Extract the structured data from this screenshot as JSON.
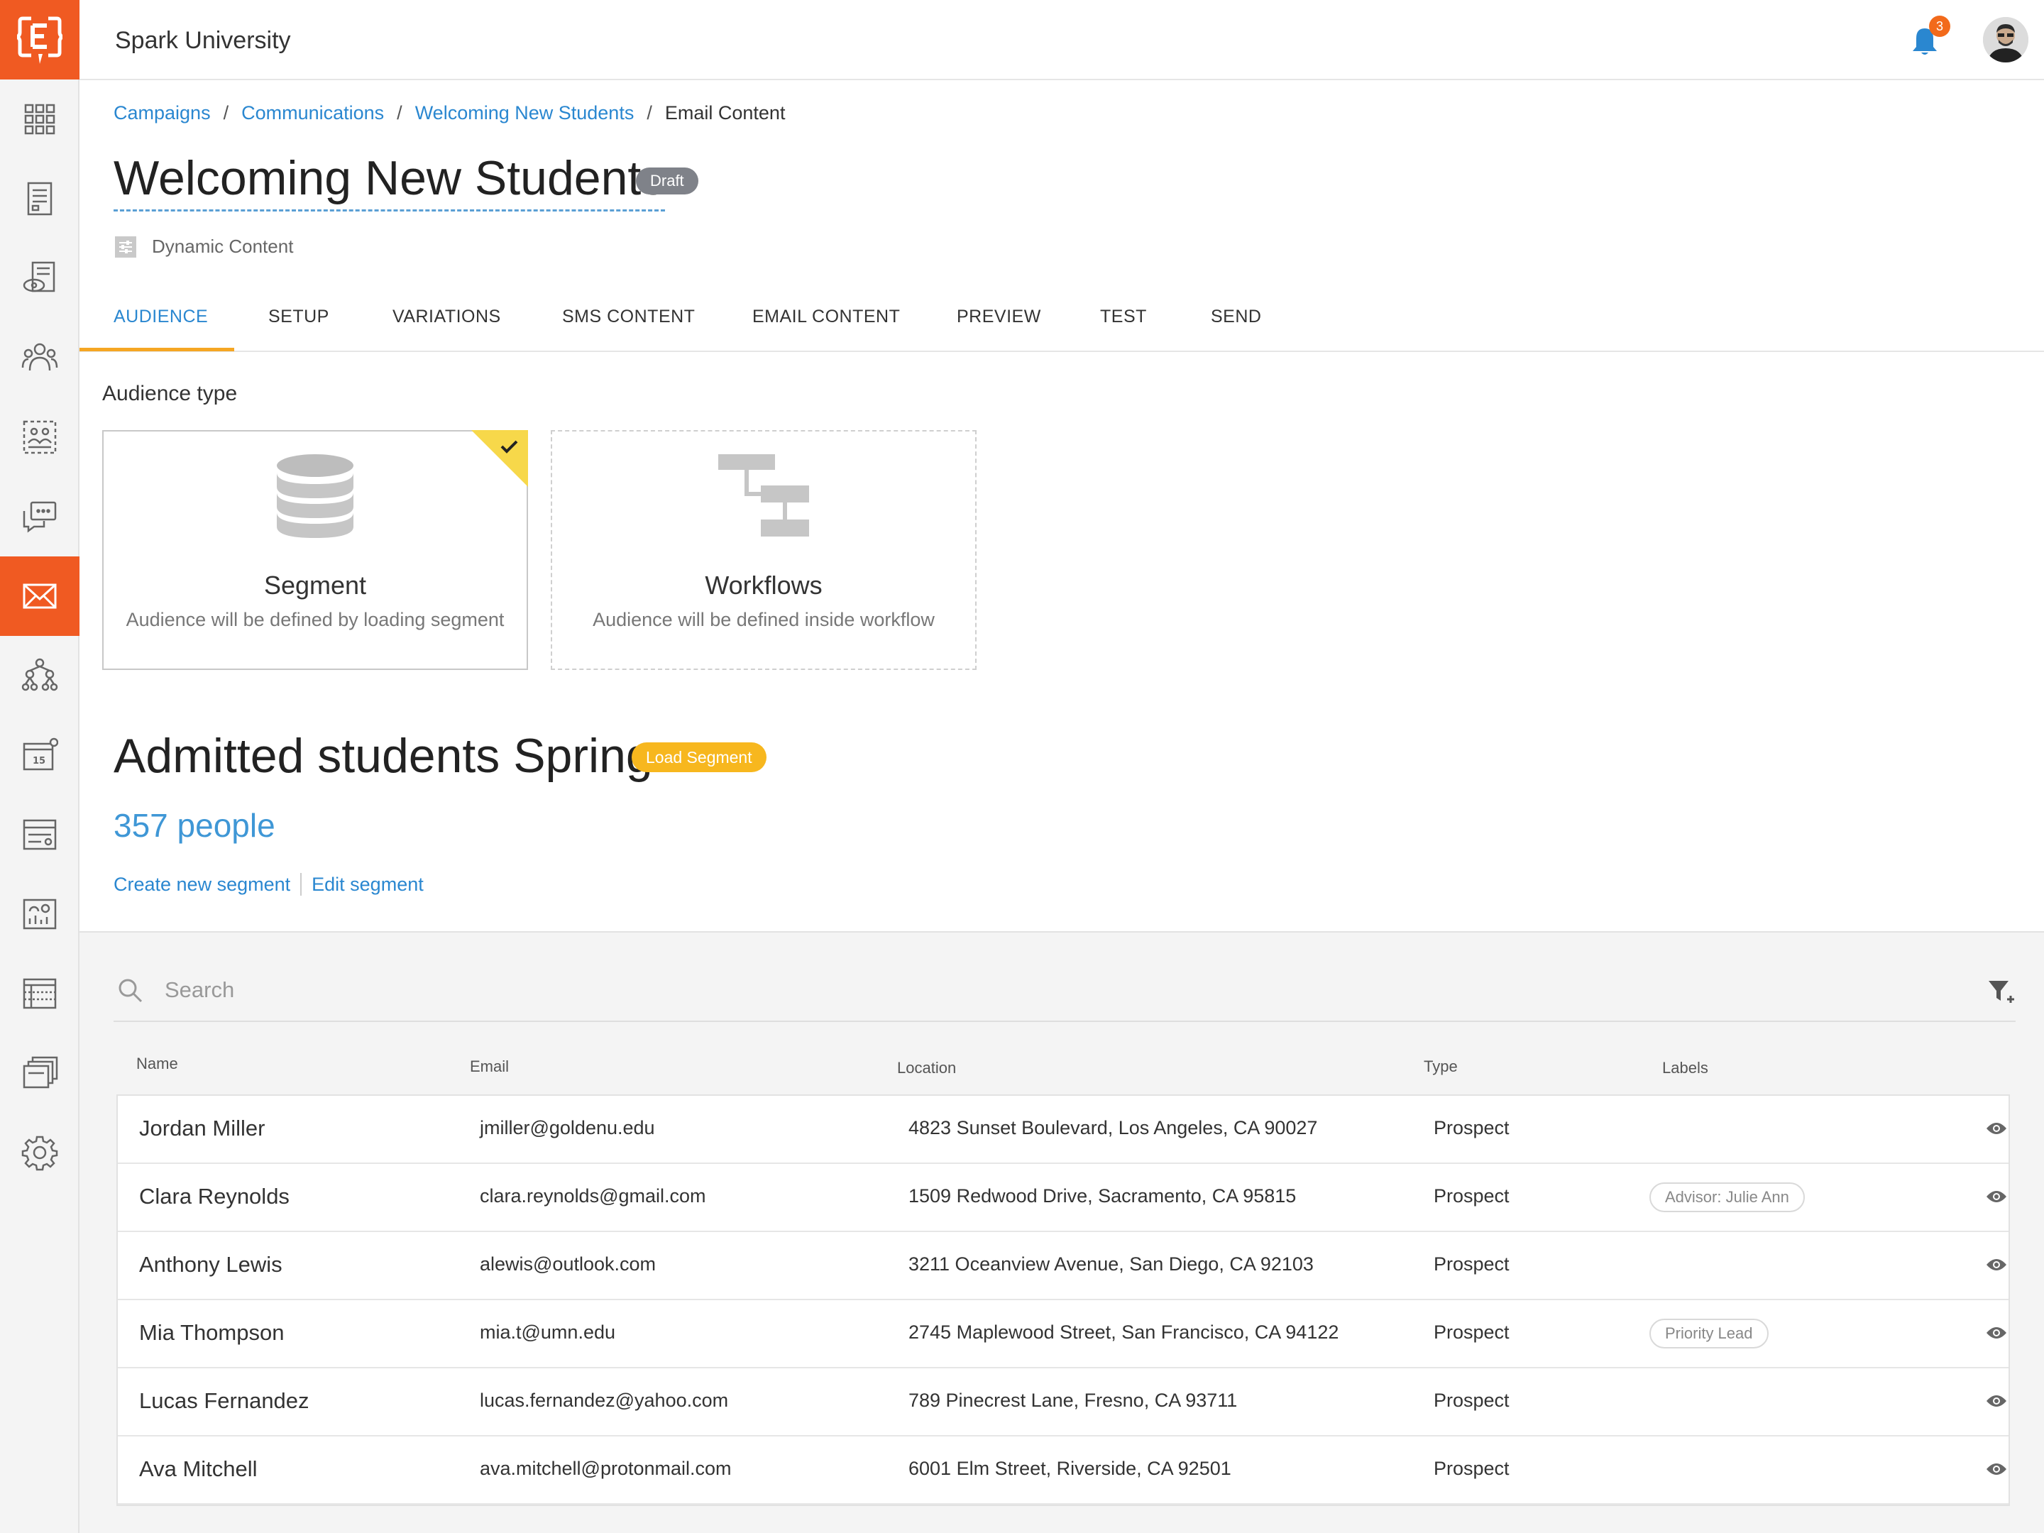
{
  "app": {
    "title": "Spark University",
    "notification_count": "3"
  },
  "sidebar": {
    "items": [
      {
        "icon": "grid-icon"
      },
      {
        "icon": "document-icon"
      },
      {
        "icon": "document-eye-icon"
      },
      {
        "icon": "people-group-icon"
      },
      {
        "icon": "audience-segment-icon"
      },
      {
        "icon": "chat-bubbles-icon"
      },
      {
        "icon": "envelope-icon",
        "active": true
      },
      {
        "icon": "org-chart-icon"
      },
      {
        "icon": "calendar-icon"
      },
      {
        "icon": "form-icon"
      },
      {
        "icon": "analytics-icon"
      },
      {
        "icon": "table-icon"
      },
      {
        "icon": "files-icon"
      },
      {
        "icon": "gear-icon"
      }
    ]
  },
  "breadcrumb": {
    "items": [
      "Campaigns",
      "Communications",
      "Welcoming New Students"
    ],
    "current": "Email Content",
    "separator": "/"
  },
  "page": {
    "title": "Welcoming New Students",
    "status": "Draft",
    "subtitle": "Dynamic Content"
  },
  "tabs": [
    "AUDIENCE",
    "SETUP",
    "VARIATIONS",
    "SMS CONTENT",
    "EMAIL CONTENT",
    "PREVIEW",
    "TEST",
    "SEND"
  ],
  "audience": {
    "label": "Audience type",
    "options": [
      {
        "title": "Segment",
        "description": "Audience will be defined by loading segment",
        "selected": true
      },
      {
        "title": "Workflows",
        "description": "Audience will be defined inside workflow",
        "selected": false
      }
    ]
  },
  "segment": {
    "name": "Admitted students Spring",
    "badge": "Load Segment",
    "count": "357 people",
    "create_link": "Create new segment",
    "edit_link": "Edit segment"
  },
  "search": {
    "placeholder": "Search"
  },
  "table": {
    "columns": [
      "Name",
      "Email",
      "Location",
      "Type",
      "Labels"
    ],
    "rows": [
      {
        "name": "Jordan Miller",
        "email": "jmiller@goldenu.edu",
        "location": "4823 Sunset Boulevard, Los Angeles, CA 90027",
        "type": "Prospect",
        "label": ""
      },
      {
        "name": "Clara Reynolds",
        "email": "clara.reynolds@gmail.com",
        "location": "1509 Redwood Drive, Sacramento, CA 95815",
        "type": "Prospect",
        "label": "Advisor: Julie Ann"
      },
      {
        "name": "Anthony Lewis",
        "email": "alewis@outlook.com",
        "location": "3211 Oceanview Avenue, San Diego, CA 92103",
        "type": "Prospect",
        "label": ""
      },
      {
        "name": "Mia Thompson",
        "email": "mia.t@umn.edu",
        "location": "2745 Maplewood Street, San Francisco, CA 94122",
        "type": "Prospect",
        "label": "Priority Lead"
      },
      {
        "name": "Lucas Fernandez",
        "email": "lucas.fernandez@yahoo.com",
        "location": "789 Pinecrest Lane, Fresno, CA 93711",
        "type": "Prospect",
        "label": ""
      },
      {
        "name": "Ava Mitchell",
        "email": "ava.mitchell@protonmail.com",
        "location": "6001 Elm Street, Riverside, CA 92501",
        "type": "Prospect",
        "label": ""
      }
    ]
  },
  "colors": {
    "brand": "#f05a22",
    "link": "#2a87d0",
    "tab_underline": "#f5a623",
    "load_badge": "#f7b71e",
    "draft_badge": "#7f8289"
  }
}
